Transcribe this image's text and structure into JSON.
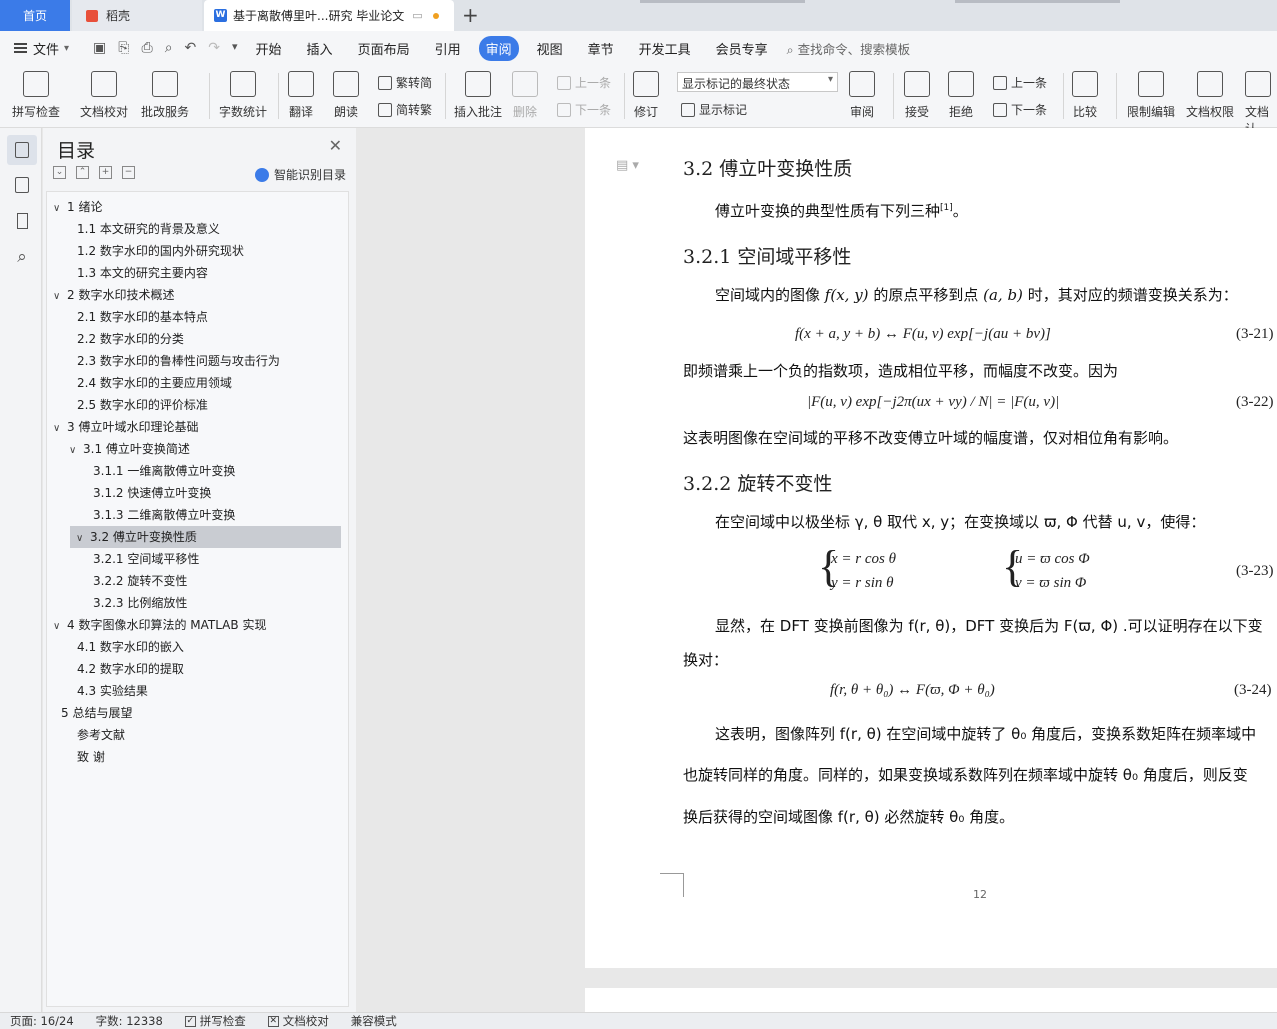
{
  "tabs": {
    "home": "首页",
    "daoke": "稻壳",
    "doc": "基于离散傅里叶...研究 毕业论文"
  },
  "menu": {
    "file": "文件",
    "items": [
      "开始",
      "插入",
      "页面布局",
      "引用",
      "审阅",
      "视图",
      "章节",
      "开发工具",
      "会员专享"
    ],
    "active": "审阅",
    "search": "查找命令、搜索模板"
  },
  "ribbon": {
    "spell": "拼写检查",
    "doc_check": "文档校对",
    "revise_service": "批改服务",
    "word_count": "字数统计",
    "translate": "翻译",
    "read": "朗读",
    "trad_to_simp": "繁转简",
    "simp_to_trad": "简转繁",
    "insert_comment": "插入批注",
    "delete": "删除",
    "prev_comment": "上一条",
    "next_comment": "下一条",
    "track": "修订",
    "markup_state": "显示标记的最终状态",
    "show_markup": "显示标记",
    "review": "审阅",
    "accept": "接受",
    "reject": "拒绝",
    "prev": "上一条",
    "next": "下一条",
    "compare": "比较",
    "restrict": "限制编辑",
    "permission": "文档权限",
    "doc_more": "文档认"
  },
  "toc": {
    "title": "目录",
    "smart": "智能识别目录",
    "items": [
      {
        "label": "1   绪论",
        "level": 1,
        "caret": "v"
      },
      {
        "label": "1.1   本文研究的背景及意义",
        "level": 2
      },
      {
        "label": "1.2   数字水印的国内外研究现状",
        "level": 2
      },
      {
        "label": "1.3   本文的研究主要内容",
        "level": 2
      },
      {
        "label": "2   数字水印技术概述",
        "level": 1,
        "caret": "v"
      },
      {
        "label": "2.1   数字水印的基本特点",
        "level": 2
      },
      {
        "label": "2.2   数字水印的分类",
        "level": 2
      },
      {
        "label": "2.3   数字水印的鲁棒性问题与攻击行为",
        "level": 2
      },
      {
        "label": "2.4   数字水印的主要应用领域",
        "level": 2
      },
      {
        "label": "2.5   数字水印的评价标准",
        "level": 2
      },
      {
        "label": "3   傅立叶域水印理论基础",
        "level": 1,
        "caret": "v"
      },
      {
        "label": "3.1   傅立叶变换简述",
        "level": 2,
        "caret": "v"
      },
      {
        "label": "3.1.1   一维离散傅立叶变换",
        "level": 3
      },
      {
        "label": "3.1.2   快速傅立叶变换",
        "level": 3
      },
      {
        "label": "3.1.3   二维离散傅立叶变换",
        "level": 3
      },
      {
        "label": "3.2   傅立叶变换性质",
        "level": 2,
        "caret": "v",
        "selected": true
      },
      {
        "label": "3.2.1   空间域平移性",
        "level": 3
      },
      {
        "label": "3.2.2   旋转不变性",
        "level": 3
      },
      {
        "label": "3.2.3   比例缩放性",
        "level": 3
      },
      {
        "label": "4   数字图像水印算法的 MATLAB  实现",
        "level": 1,
        "caret": "v"
      },
      {
        "label": "4.1 数字水印的嵌入",
        "level": 2
      },
      {
        "label": "4.2 数字水印的提取",
        "level": 2
      },
      {
        "label": "4.3 实验结果",
        "level": 2
      },
      {
        "label": "5   总结与展望",
        "level": 1
      },
      {
        "label": "参考文献",
        "level": 0
      },
      {
        "label": "致   谢",
        "level": 0
      }
    ]
  },
  "doc": {
    "h_32": "3.2    傅立叶变换性质",
    "p1": "傅立叶变换的典型性质有下列三种",
    "p1_ref": "[1]",
    "p1_end": "。",
    "h_321": "3.2.1    空间域平移性",
    "p2a": "空间域内的图像",
    "p2b": "f(x, y)",
    "p2c": "的原点平移到点",
    "p2d": "(a, b)",
    "p2e": "时，其对应的频谱变换关系为：",
    "eq21": "f(x + a, y + b) ↔ F(u, v) exp[−j(au + bv)]",
    "eq21_no": "(3-21)",
    "p3": "即频谱乘上一个负的指数项，造成相位平移，而幅度不改变。因为",
    "eq22": "|F(u, v) exp[−j2π(ux + vy) / N| = |F(u, v)|",
    "eq22_no": "(3-22)",
    "p4": "这表明图像在空间域的平移不改变傅立叶域的幅度谱，仅对相位角有影响。",
    "h_322": "3.2.2    旋转不变性",
    "p5": "在空间域中以极坐标 γ, θ 取代 x, y；在变换域以 ϖ, Φ 代替 u, v，使得：",
    "eq23_l1": "x = r cos θ",
    "eq23_l2": "y = r sin  θ",
    "eq23_r1": "u = ϖ cos Φ",
    "eq23_r2": "v = ϖ sin  Φ",
    "eq23_no": "(3-23)",
    "p6a": "显然，在 DFT 变换前图像为 f(r, θ)，DFT 变换后为 F(ϖ, Φ) .可以证明存在以下变",
    "p6b": "换对：",
    "eq24": "f(r, θ + θ₀) ↔ F(ϖ, Φ + θ₀)",
    "eq24_no": "(3-24)",
    "p7a": "这表明，图像阵列 f(r, θ) 在空间域中旋转了 θ₀ 角度后，变换系数矩阵在频率域中",
    "p7b": "也旋转同样的角度。同样的，如果变换域系数阵列在频率域中旋转 θ₀ 角度后，则反变",
    "p7c": "换后获得的空间域图像 f(r, θ) 必然旋转 θ₀ 角度。",
    "page_number": "12"
  },
  "status": {
    "page": "页面: 16/24",
    "words": "字数: 12338",
    "spell": "拼写检查",
    "proof": "文档校对",
    "compat": "兼容模式"
  }
}
